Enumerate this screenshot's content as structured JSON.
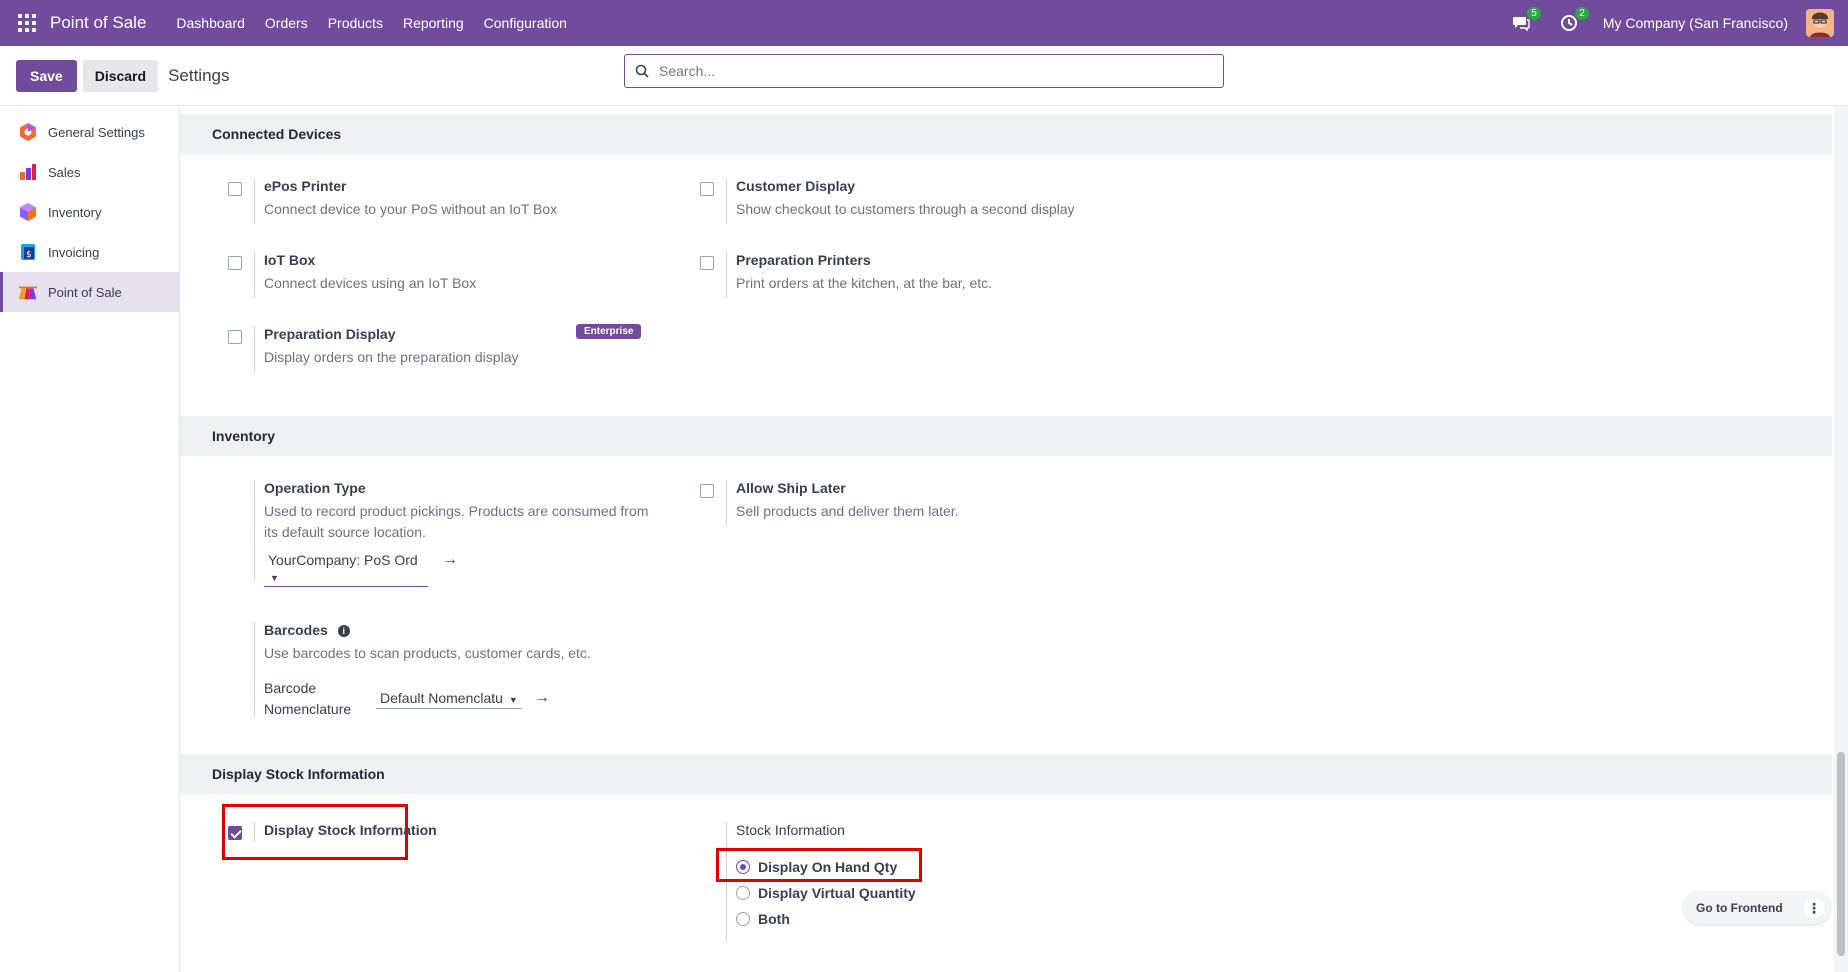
{
  "navbar": {
    "brand": "Point of Sale",
    "menu": [
      "Dashboard",
      "Orders",
      "Products",
      "Reporting",
      "Configuration"
    ],
    "messages_count": "5",
    "activities_count": "2",
    "company": "My Company (San Francisco)"
  },
  "control_panel": {
    "save_label": "Save",
    "discard_label": "Discard",
    "title": "Settings",
    "search_placeholder": "Search..."
  },
  "sidebar": {
    "items": [
      {
        "label": "General Settings",
        "icon": "general-settings-icon"
      },
      {
        "label": "Sales",
        "icon": "sales-icon"
      },
      {
        "label": "Inventory",
        "icon": "inventory-icon"
      },
      {
        "label": "Invoicing",
        "icon": "invoicing-icon"
      },
      {
        "label": "Point of Sale",
        "icon": "point-of-sale-icon",
        "active": true
      }
    ]
  },
  "connected_devices": {
    "title": "Connected Devices",
    "epos": {
      "title": "ePos Printer",
      "desc": "Connect device to your PoS without an IoT Box"
    },
    "customer_display": {
      "title": "Customer Display",
      "desc": "Show checkout to customers through a second display"
    },
    "iot_box": {
      "title": "IoT Box",
      "desc": "Connect devices using an IoT Box"
    },
    "prep_printers": {
      "title": "Preparation Printers",
      "desc": "Print orders at the kitchen, at the bar, etc."
    },
    "prep_display": {
      "title": "Preparation Display",
      "desc": "Display orders on the preparation display",
      "badge": "Enterprise"
    }
  },
  "inventory": {
    "title": "Inventory",
    "operation_type": {
      "title": "Operation Type",
      "desc_line1": "Used to record product pickings. Products are consumed from",
      "desc_line2": "its default source location.",
      "value": "YourCompany: PoS Ord"
    },
    "allow_ship_later": {
      "title": "Allow Ship Later",
      "desc": "Sell products and deliver them later."
    },
    "barcodes": {
      "title": "Barcodes",
      "desc": "Use barcodes to scan products, customer cards, etc.",
      "field_label_line1": "Barcode",
      "field_label_line2": "Nomenclature",
      "value": "Default Nomenclatu"
    }
  },
  "display_stock": {
    "title": "Display Stock Information",
    "checkbox_label": "Display Stock Information",
    "checked": true,
    "stock_info_title": "Stock Information",
    "options": [
      "Display On Hand Qty",
      "Display Virtual Quantity",
      "Both"
    ],
    "selected": "Display On Hand Qty"
  },
  "frontend": {
    "label": "Go to Frontend"
  },
  "colors": {
    "brand": "#714B9C",
    "highlight": "#E00000",
    "badge": "#2FA44A"
  }
}
